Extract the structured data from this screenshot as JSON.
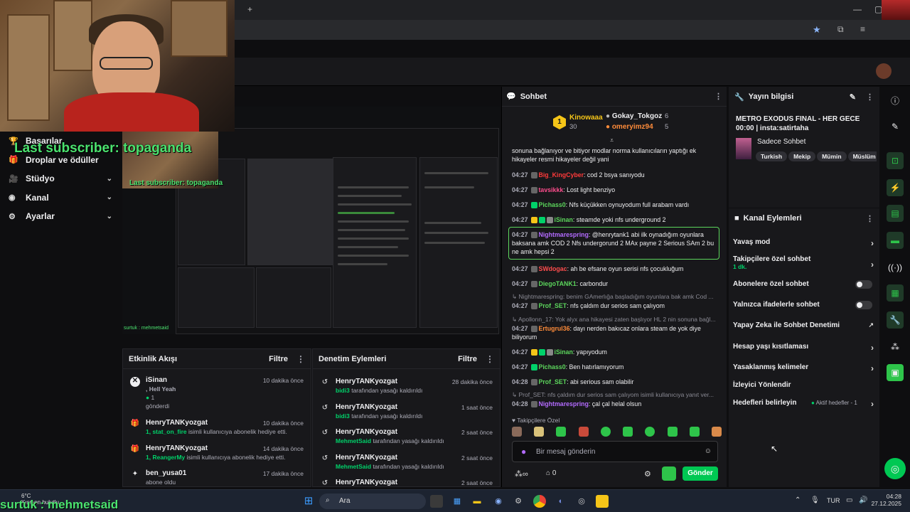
{
  "browser": {
    "new_tab": "+",
    "minimize": "—",
    "maximize": "▢"
  },
  "overlay": {
    "last_subscriber": "Last subscriber: topaganda",
    "bottom_text": "surtuk : mehmetsaid",
    "small_text": "surtuk : mehmetsaid"
  },
  "left_menu": [
    {
      "icon": "trophy-icon",
      "glyph": "🏆",
      "label": "Başarılar",
      "chev": ""
    },
    {
      "icon": "gift-icon",
      "glyph": "🎁",
      "label": "Droplar ve ödüller",
      "chev": ""
    },
    {
      "icon": "video-icon",
      "glyph": "🎥",
      "label": "Stüdyo",
      "chev": "⌄"
    },
    {
      "icon": "broadcast-icon",
      "glyph": "◉",
      "label": "Kanal",
      "chev": "⌄"
    },
    {
      "icon": "gear-icon",
      "glyph": "⚙",
      "label": "Ayarlar",
      "chev": "⌄"
    }
  ],
  "activity_feed": {
    "title": "Etkinlik Akışı",
    "filter": "Filtre",
    "items": [
      {
        "name": "iSinan",
        "time": "10 dakika önce",
        "line1": ", Hell Yeah",
        "line2": "1",
        "line3": "gönderdi",
        "icon_color": "#dddddd"
      },
      {
        "name": "HenryTANKyozgat",
        "time": "10 dakika önce",
        "highlight": "1, stat_on_fire",
        "rest": " isimli kullanıcıya abonelik hediye etti.",
        "icon_color": "#00d26a"
      },
      {
        "name": "HenryTANKyozgat",
        "time": "14 dakika önce",
        "highlight": "1, ReangerMy",
        "rest": " isimli kullanıcıya abonelik hediye etti.",
        "icon_color": "#00d26a"
      },
      {
        "name": "ben_yusa01",
        "time": "17 dakika önce",
        "highlight": "",
        "rest": "abone oldu",
        "icon_color": "#dddddd"
      }
    ]
  },
  "mod_actions": {
    "title": "Denetim Eylemleri",
    "filter": "Filtre",
    "items": [
      {
        "name": "HenryTANKyozgat",
        "time": "28 dakika önce",
        "actor": "bidi3",
        "rest": " tarafından yasağı kaldırıldı"
      },
      {
        "name": "HenryTANKyozgat",
        "time": "1 saat önce",
        "actor": "bidi3",
        "rest": " tarafından yasağı kaldırıldı"
      },
      {
        "name": "HenryTANKyozgat",
        "time": "2 saat önce",
        "actor": "MehmetSaid",
        "rest": " tarafından yasağı kaldırıldı"
      },
      {
        "name": "HenryTANKyozgat",
        "time": "2 saat önce",
        "actor": "MehmetSaid",
        "rest": " tarafından yasağı kaldırıldı"
      },
      {
        "name": "HenryTANKyozgat",
        "time": "2 saat önce",
        "actor": "",
        "rest": ""
      }
    ]
  },
  "chat": {
    "title": "Sohbet",
    "leaders": [
      {
        "name": "Kinowaaa",
        "count": "30",
        "rank": "1"
      },
      {
        "name": "Gokay_Tokgoz",
        "count": "6"
      },
      {
        "name": "omeryimz94",
        "count": "5"
      }
    ],
    "messages": [
      {
        "time": "",
        "user": "",
        "color": "#efeff1",
        "text": "sonuna bağlanıyor ve bitiyor modlar norma kullanıcıların yaptığı ek hikayeler resmi hikayeler değil yani"
      },
      {
        "time": "04:27",
        "user": "Big_KingCyber",
        "color": "#ff3a3a",
        "text": ": cod 2 bsya sanıyodu"
      },
      {
        "time": "04:27",
        "user": "tavsikkk",
        "color": "#ff4d8d",
        "text": ": Lost light benziyo"
      },
      {
        "time": "04:27",
        "user": "Pichass0",
        "color": "#5cd65c",
        "text": ": Nfs küçükken oynuyodum full arabam vardı"
      },
      {
        "time": "04:27",
        "user": "iSinan",
        "color": "#5cd65c",
        "text": ": steamde yoki nfs underground 2"
      },
      {
        "time": "04:27",
        "user": "Nightmarespring",
        "color": "#b36bff",
        "text": ": @henrytank1 abi ilk oynadığım oyunlara baksana amk COD 2 Nfs undergorund 2 MAx payne 2 Serious SAm 2 bu ne amk hepsi 2"
      },
      {
        "time": "04:27",
        "user": "SWdogac",
        "color": "#ff4d4d",
        "text": ": ah be efsane oyun serisi nfs çocukluğum"
      },
      {
        "time": "04:27",
        "user": "DiegoTANK1",
        "color": "#5cd65c",
        "text": ": carbondur"
      },
      {
        "reply": "↳ Nightmarespring: benim GAmerlığa başladığım oyunlara bak amk Cod ..."
      },
      {
        "time": "04:27",
        "user": "Prof_SET",
        "color": "#5cd65c",
        "text": ": nfs çaldım dur serios sam çalıyom"
      },
      {
        "reply": "↳ Apollonn_17: Yok alyx ana hikayesi zaten başlıyor HL 2 nin sonuna bağl..."
      },
      {
        "time": "04:27",
        "user": "Ertugrul36",
        "color": "#ff8c3a",
        "text": ": dayı nerden bakıcaz onlara steam de yok diye biliyorum"
      },
      {
        "time": "04:27",
        "user": "iSinan",
        "color": "#5cd65c",
        "text": ": yapıyodum"
      },
      {
        "time": "04:27",
        "user": "Pichass0",
        "color": "#5cd65c",
        "text": ": Ben hatırlamıyorum"
      },
      {
        "time": "04:28",
        "user": "Prof_SET",
        "color": "#5cd65c",
        "text": ": abi serious sam olabilir"
      },
      {
        "reply": "↳ Prof_SET: nfs çaldım dur serios sam çalıyom isimli kullanıcıya yanıt ver..."
      },
      {
        "time": "04:28",
        "user": "Nightmarespring",
        "color": "#b36bff",
        "text": ": çal çal helal olsun"
      }
    ],
    "emote_label": "Takipçilere Özel",
    "input_placeholder": "Bir mesaj gönderin",
    "points": "0",
    "send": "Gönder"
  },
  "stream_info": {
    "header": "Yayın bilgisi",
    "title": "METRO EXODUS FINAL - HER GECE 00:00 | insta:satirtaha",
    "category": "Sadece Sohbet",
    "tags": [
      "Turkish",
      "Mekip",
      "Mümin",
      "Müslüm"
    ]
  },
  "channel_actions": {
    "header": "Kanal Eylemleri",
    "items": [
      {
        "label": "Yavaş mod",
        "type": "chev",
        "sub": ""
      },
      {
        "label": "Takipçilere özel sohbet",
        "type": "chev",
        "sub": "1 dk."
      },
      {
        "label": "Abonelere özel sohbet",
        "type": "toggle",
        "sub": ""
      },
      {
        "label": "Yalnızca ifadelerle sohbet",
        "type": "toggle",
        "sub": ""
      },
      {
        "label": "Yapay Zeka ile Sohbet Denetimi",
        "type": "ext",
        "sub": ""
      },
      {
        "label": "Hesap yaşı kısıtlaması",
        "type": "chev",
        "sub": ""
      },
      {
        "label": "Yasaklanmış kelimeler",
        "type": "chev",
        "sub": ""
      },
      {
        "label": "İzleyici Yönlendir",
        "type": "none",
        "sub": ""
      },
      {
        "label": "Hedefleri belirleyin",
        "type": "chev",
        "sub": "",
        "badge": "Aktif hedefler - 1"
      }
    ]
  },
  "taskbar": {
    "search": "Ara",
    "weather": "6°C",
    "weather_sub": "Kısmen bulutlu",
    "lang": "TUR",
    "time": "04:28",
    "date": "27.12.2025"
  }
}
